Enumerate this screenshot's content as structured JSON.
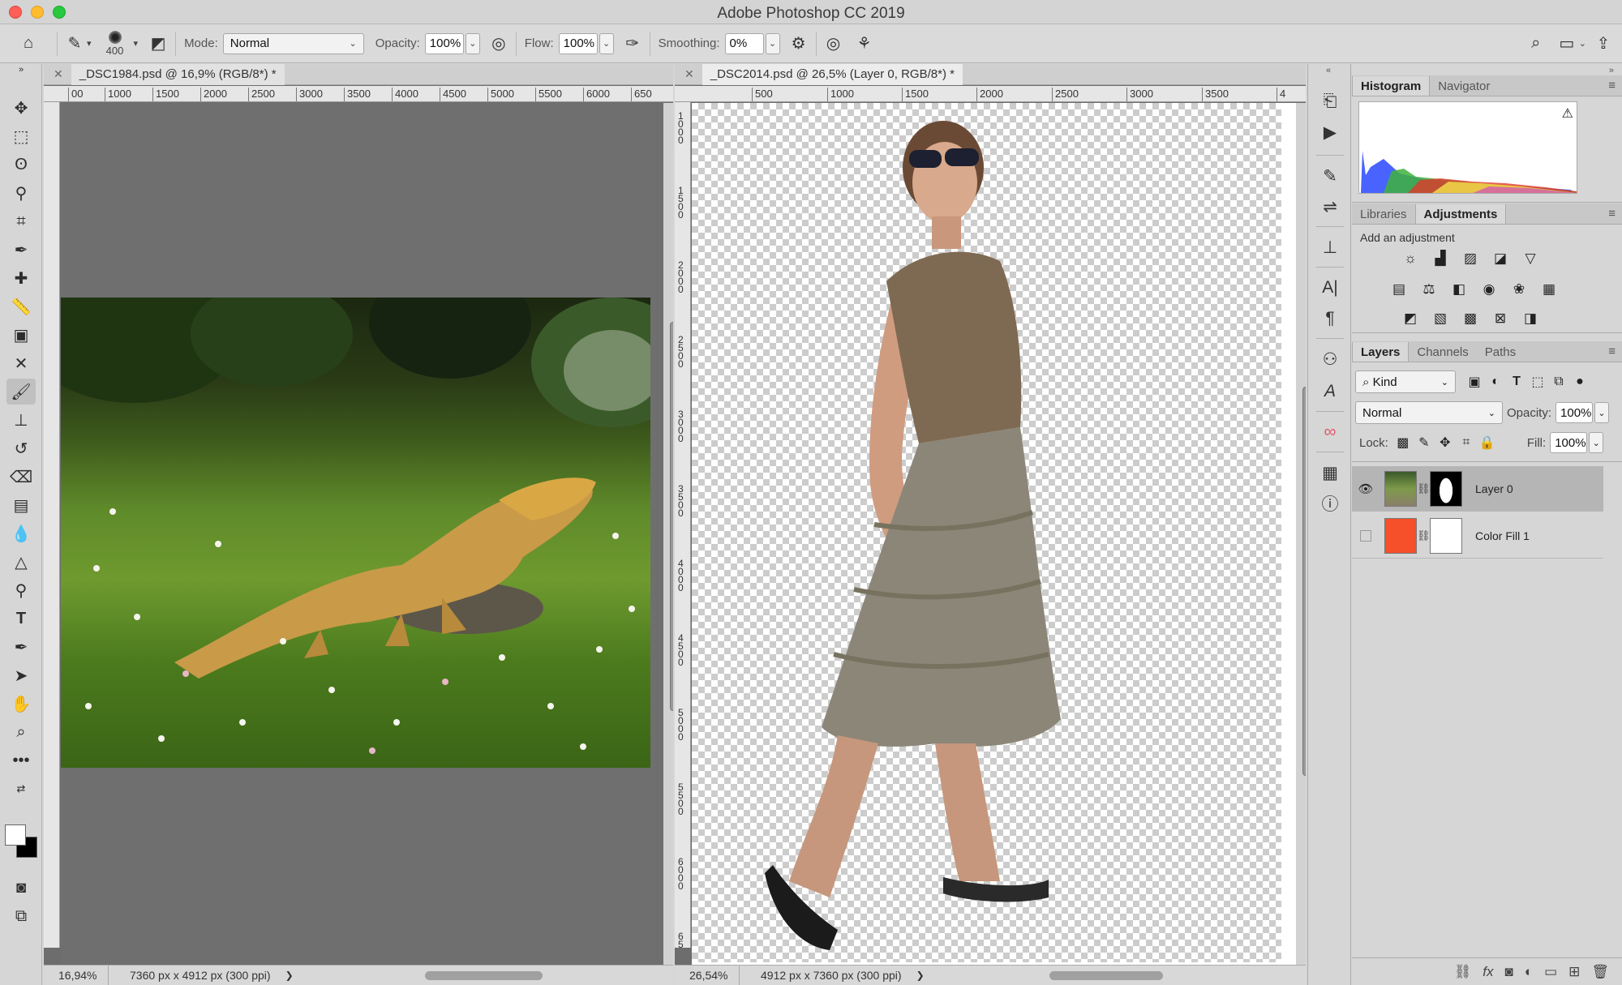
{
  "window": {
    "title": "Adobe Photoshop CC 2019"
  },
  "options": {
    "brush_size": "400",
    "mode_label": "Mode:",
    "mode_value": "Normal",
    "opacity_label": "Opacity:",
    "opacity_value": "100%",
    "flow_label": "Flow:",
    "flow_value": "100%",
    "smoothing_label": "Smoothing:",
    "smoothing_value": "0%"
  },
  "doc1": {
    "tab": "_DSC1984.psd @ 16,9% (RGB/8*) *",
    "ruler": [
      "00",
      "1000",
      "1500",
      "2000",
      "2500",
      "3000",
      "3500",
      "4000",
      "4500",
      "5000",
      "5500",
      "6000",
      "650"
    ],
    "zoom": "16,94%",
    "info": "7360 px x 4912 px (300 ppi)"
  },
  "doc2": {
    "tab": "_DSC2014.psd @ 26,5% (Layer 0, RGB/8*) *",
    "ruler": [
      "500",
      "1000",
      "1500",
      "2000",
      "2500",
      "3000",
      "3500",
      "4"
    ],
    "vruler": [
      "1000",
      "1500",
      "2000",
      "2500",
      "3000",
      "3500",
      "4000",
      "4500",
      "5000",
      "5500",
      "6000",
      "65"
    ],
    "zoom": "26,54%",
    "info": "4912 px x 7360 px (300 ppi)"
  },
  "panels": {
    "histogram_tabs": [
      "Histogram",
      "Navigator"
    ],
    "adjust_tabs": [
      "Libraries",
      "Adjustments"
    ],
    "add_adjustment": "Add an adjustment",
    "layers_tabs": [
      "Layers",
      "Channels",
      "Paths"
    ],
    "kind": "Kind",
    "blend_mode": "Normal",
    "opacity_label": "Opacity:",
    "opacity_value": "100%",
    "lock_label": "Lock:",
    "fill_label": "Fill:",
    "fill_value": "100%",
    "layers": [
      {
        "name": "Layer 0",
        "visible": true,
        "selected": true
      },
      {
        "name": "Color Fill 1",
        "visible": false,
        "selected": false,
        "fill_color": "#f5502a"
      }
    ]
  },
  "colors": {
    "accent_fill": "#f5502a",
    "foreground": "#ffffff",
    "background": "#000000"
  }
}
